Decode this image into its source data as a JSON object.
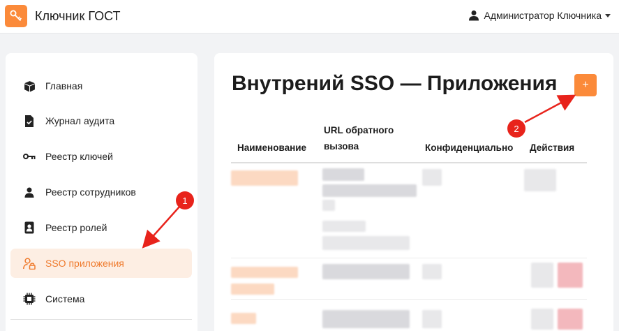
{
  "app": {
    "title": "Ключник ГОСТ"
  },
  "user": {
    "name": "Администратор Ключника"
  },
  "sidebar": {
    "items": [
      {
        "label": "Главная",
        "icon": "box-icon"
      },
      {
        "label": "Журнал аудита",
        "icon": "document-check-icon"
      },
      {
        "label": "Реестр ключей",
        "icon": "key-icon"
      },
      {
        "label": "Реестр сотрудников",
        "icon": "person-icon"
      },
      {
        "label": "Реестр ролей",
        "icon": "id-badge-icon"
      },
      {
        "label": "SSO приложения",
        "icon": "user-lock-icon",
        "active": true
      },
      {
        "label": "Система",
        "icon": "chip-icon"
      }
    ]
  },
  "main": {
    "title": "Внутрений SSO — Приложения",
    "add_button_label": "+",
    "table": {
      "columns": [
        "Наименование",
        "URL обратного вызова",
        "Конфиденциально",
        "Действия"
      ]
    }
  },
  "annotations": [
    {
      "number": "1",
      "color": "#e8231b"
    },
    {
      "number": "2",
      "color": "#e8231b"
    }
  ],
  "colors": {
    "accent": "#fb8a3a",
    "active_bg": "#fdeee3",
    "annotation": "#e8231b"
  }
}
